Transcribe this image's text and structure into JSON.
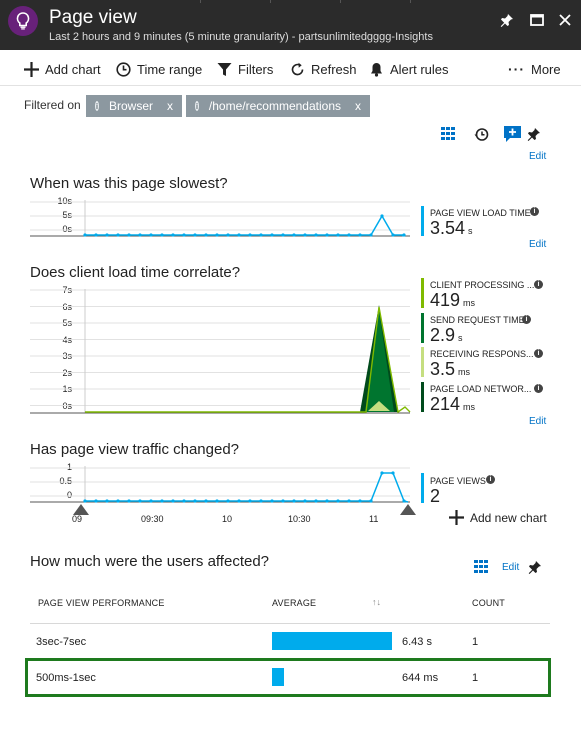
{
  "header": {
    "title": "Page view",
    "subtitle": "Last 2 hours and 9 minutes (5 minute granularity) - partsunlimitedgggg-Insights"
  },
  "toolbar": {
    "add_chart": "Add chart",
    "time_range": "Time range",
    "filters": "Filters",
    "refresh": "Refresh",
    "alert_rules": "Alert rules",
    "more": "More"
  },
  "filters": {
    "label": "Filtered on",
    "chips": [
      {
        "text": "Browser",
        "close": "x"
      },
      {
        "text": "/home/recommendations",
        "close": "x"
      }
    ]
  },
  "edit_label": "Edit",
  "chart1": {
    "title": "When was this page slowest?",
    "y_ticks": [
      "10s",
      "5s",
      "0s"
    ],
    "metric_name": "PAGE VIEW LOAD TIME",
    "metric_value": "3.54",
    "metric_unit": "s"
  },
  "chart2": {
    "title": "Does client load time correlate?",
    "y_ticks": [
      "7s",
      "6s",
      "5s",
      "4s",
      "3s",
      "2s",
      "1s",
      "0s"
    ],
    "metrics": [
      {
        "name": "CLIENT PROCESSING ...",
        "value": "419",
        "unit": "ms",
        "color": "#7fba00"
      },
      {
        "name": "SEND REQUEST TIME",
        "value": "2.9",
        "unit": "s",
        "color": "#00752f"
      },
      {
        "name": "RECEIVING RESPONS...",
        "value": "3.5",
        "unit": "ms",
        "color": "#c5de80"
      },
      {
        "name": "PAGE LOAD NETWOR...",
        "value": "214",
        "unit": "ms",
        "color": "#004b1c"
      }
    ]
  },
  "chart3": {
    "title": "Has page view traffic changed?",
    "y_ticks": [
      "1",
      "0.5",
      "0"
    ],
    "x_ticks": [
      "09",
      "09:30",
      "10",
      "10:30",
      "11"
    ],
    "metric_name": "PAGE VIEWS",
    "metric_value": "2",
    "add_new_chart": "Add new chart"
  },
  "users_section": {
    "title": "How much were the users affected?",
    "edit": "Edit",
    "columns": [
      "PAGE VIEW PERFORMANCE",
      "AVERAGE",
      "COUNT"
    ],
    "rows": [
      {
        "bucket": "3sec-7sec",
        "average": "6.43 s",
        "count": "1",
        "avg_fraction": 1.0
      },
      {
        "bucket": "500ms-1sec",
        "average": "644 ms",
        "count": "1",
        "avg_fraction": 0.1
      }
    ]
  },
  "colors": {
    "accent": "#00abec",
    "header_bg": "#2b2b2b",
    "link": "#0072c6",
    "highlight": "#1e7a1e"
  }
}
